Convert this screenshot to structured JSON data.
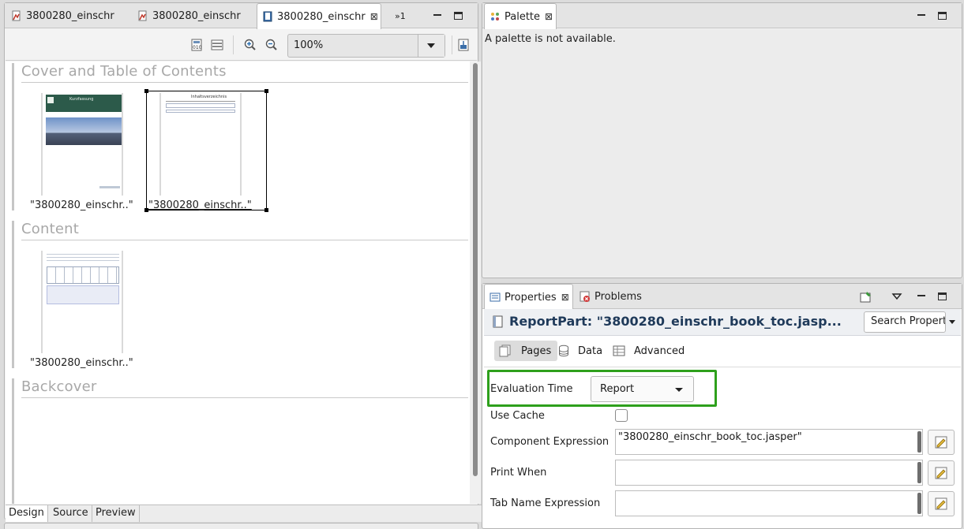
{
  "editor": {
    "tabs": [
      {
        "label": "3800280_einschr",
        "active": false
      },
      {
        "label": "3800280_einschr",
        "active": false
      },
      {
        "label": "3800280_einschr",
        "active": true
      }
    ],
    "overflow_label": "»1",
    "zoom": "100%",
    "sections": {
      "cover": {
        "title": "Cover and Table of Contents",
        "items": [
          {
            "caption": "\"3800280_einschr..\""
          },
          {
            "caption": "\"3800280_einschr..\""
          }
        ]
      },
      "content": {
        "title": "Content",
        "items": [
          {
            "caption": "\"3800280_einschr..\""
          }
        ]
      },
      "backcover": {
        "title": "Backcover"
      }
    },
    "bottom_tabs": [
      "Design",
      "Source",
      "Preview"
    ],
    "cover_thumbnail_text": "Kurzfassung",
    "toc_thumbnail_text": "Inhaltsverzeichnis"
  },
  "palette": {
    "tab_label": "Palette",
    "message": "A palette is not available."
  },
  "properties": {
    "tabs": [
      {
        "label": "Properties",
        "active": true
      },
      {
        "label": "Problems",
        "active": false
      }
    ],
    "header": "ReportPart: \"3800280_einschr_book_toc.jasp...",
    "search_placeholder": "Search Properties",
    "subtabs": [
      "Pages",
      "Data",
      "Advanced"
    ],
    "fields": {
      "evaluation_time": {
        "label": "Evaluation Time",
        "value": "Report"
      },
      "use_cache": {
        "label": "Use Cache",
        "checked": false
      },
      "component_expression": {
        "label": "Component Expression",
        "value": "\"3800280_einschr_book_toc.jasper\""
      },
      "print_when": {
        "label": "Print When",
        "value": ""
      },
      "tab_name_expression": {
        "label": "Tab Name Expression",
        "value": ""
      }
    },
    "highlight_color": "#2ea01c"
  }
}
